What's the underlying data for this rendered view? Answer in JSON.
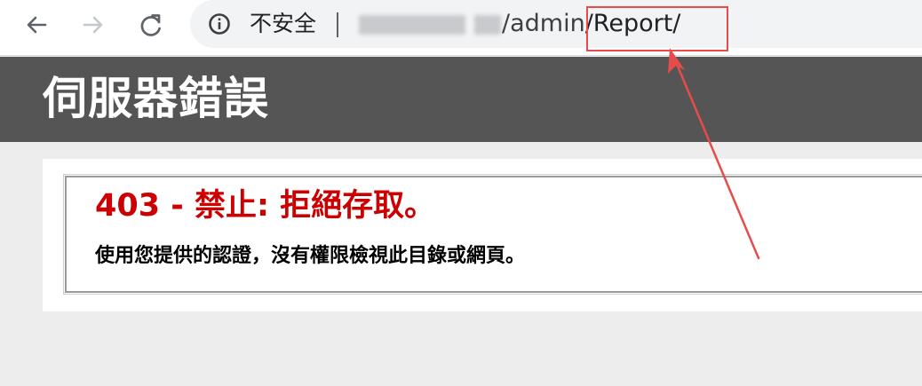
{
  "browser": {
    "security_label": "不安全",
    "url_path_prefix": "/admin",
    "url_path_highlight": "/Report/",
    "icons": {
      "back": "back-arrow-icon",
      "forward": "forward-arrow-icon",
      "reload": "reload-icon",
      "info": "info-icon"
    }
  },
  "page": {
    "header_title": "伺服器錯誤",
    "error_title": "403 - 禁止: 拒絕存取。",
    "error_message": "使用您提供的認證，沒有權限檢視此目錄或網頁。"
  },
  "colors": {
    "header_background": "#555555",
    "error_title": "#cc0000",
    "annotation": "#e74c4c",
    "page_background": "#ededed"
  }
}
